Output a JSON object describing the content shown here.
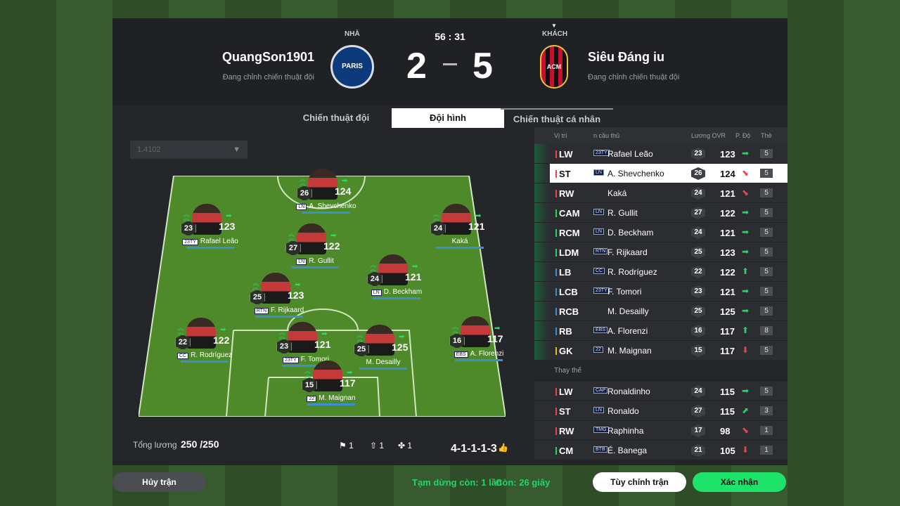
{
  "header": {
    "home_side": "NHÀ",
    "away_side": "KHÁCH",
    "home_name": "QuangSon1901",
    "away_name": "Siêu Đáng iu",
    "home_status": "Đang chỉnh chiến thuật đội",
    "away_status": "Đang chỉnh chiến thuật đội",
    "clock": "56 : 31",
    "home_score": "2",
    "away_score": "5",
    "home_crest": "PARIS",
    "away_crest": "ACM"
  },
  "tabs": [
    {
      "label": "Chiến thuật đội"
    },
    {
      "label": "Đội hình"
    },
    {
      "label": "Chiến thuật cá nhân"
    }
  ],
  "dropdown": {
    "value": "1.4102"
  },
  "players": [
    {
      "name": "A. Shevchenko",
      "badge": "LN",
      "rank": "26",
      "ovr": "124"
    },
    {
      "name": "Rafael Leão",
      "badge": "23TY",
      "rank": "23",
      "ovr": "123"
    },
    {
      "name": "Kaká",
      "badge": "",
      "rank": "24",
      "ovr": "121"
    },
    {
      "name": "R. Gullit",
      "badge": "LN",
      "rank": "27",
      "ovr": "122"
    },
    {
      "name": "D. Beckham",
      "badge": "LN",
      "rank": "24",
      "ovr": "121"
    },
    {
      "name": "F. Rijkaard",
      "badge": "RTN",
      "rank": "25",
      "ovr": "123"
    },
    {
      "name": "R. Rodríguez",
      "badge": "CC",
      "rank": "22",
      "ovr": "122"
    },
    {
      "name": "F. Tomori",
      "badge": "23TY",
      "rank": "23",
      "ovr": "121"
    },
    {
      "name": "M. Desailly",
      "badge": "",
      "rank": "25",
      "ovr": "125"
    },
    {
      "name": "A. Florenzi",
      "badge": "EBS",
      "rank": "16",
      "ovr": "117"
    },
    {
      "name": "M. Maignan",
      "badge": "22",
      "rank": "15",
      "ovr": "117"
    }
  ],
  "footer": {
    "total_label": "Tổng lương",
    "total_value": "250 /250",
    "c1": "1",
    "c2": "1",
    "c3": "1",
    "formation": "4-1-1-1-3"
  },
  "list": {
    "col_pos": "Vị trí",
    "col_name": "n cầu thủ",
    "col_ovr": "Lương OVR",
    "col_form": "P. Độ",
    "col_lvl": "Thẻ",
    "subs_label": "Thay thế",
    "rows": [
      {
        "pos": "LW",
        "badge": "23TY",
        "name": "Rafael Leão",
        "rank": "23",
        "ovr": "123",
        "trend": "➡",
        "lv": "5",
        "tc": "#2ad06a",
        "pc": "#e84848"
      },
      {
        "pos": "ST",
        "badge": "LN",
        "name": "A. Shevchenko",
        "rank": "26",
        "ovr": "124",
        "trend": "⬊",
        "lv": "5",
        "tc": "#e84848",
        "pc": "#e84848"
      },
      {
        "pos": "RW",
        "badge": "",
        "name": "Kaká",
        "rank": "24",
        "ovr": "121",
        "trend": "⬊",
        "lv": "5",
        "tc": "#e84848",
        "pc": "#e84848"
      },
      {
        "pos": "CAM",
        "badge": "LN",
        "name": "R. Gullit",
        "rank": "27",
        "ovr": "122",
        "trend": "➡",
        "lv": "5",
        "tc": "#2ad06a",
        "pc": "#2ad06a"
      },
      {
        "pos": "RCM",
        "badge": "LN",
        "name": "D. Beckham",
        "rank": "24",
        "ovr": "121",
        "trend": "➡",
        "lv": "5",
        "tc": "#2ad06a",
        "pc": "#2ad06a"
      },
      {
        "pos": "LDM",
        "badge": "RTN",
        "name": "F. Rijkaard",
        "rank": "25",
        "ovr": "123",
        "trend": "➡",
        "lv": "5",
        "tc": "#2ad06a",
        "pc": "#2ad06a"
      },
      {
        "pos": "LB",
        "badge": "CC",
        "name": "R. Rodríguez",
        "rank": "22",
        "ovr": "122",
        "trend": "⬆",
        "lv": "5",
        "tc": "#2ad06a",
        "pc": "#3a90d0"
      },
      {
        "pos": "LCB",
        "badge": "23TY",
        "name": "F. Tomori",
        "rank": "23",
        "ovr": "121",
        "trend": "➡",
        "lv": "5",
        "tc": "#2ad06a",
        "pc": "#3a90d0"
      },
      {
        "pos": "RCB",
        "badge": "",
        "name": "M. Desailly",
        "rank": "25",
        "ovr": "125",
        "trend": "➡",
        "lv": "5",
        "tc": "#2ad06a",
        "pc": "#3a90d0"
      },
      {
        "pos": "RB",
        "badge": "EBS",
        "name": "A. Florenzi",
        "rank": "16",
        "ovr": "117",
        "trend": "⬆",
        "lv": "8",
        "tc": "#2ad06a",
        "pc": "#3a90d0"
      },
      {
        "pos": "GK",
        "badge": "22",
        "name": "M. Maignan",
        "rank": "15",
        "ovr": "117",
        "trend": "⬇",
        "lv": "5",
        "tc": "#e84848",
        "pc": "#e8b830"
      }
    ],
    "subs": [
      {
        "pos": "LW",
        "badge": "CAP",
        "name": "Ronaldinho",
        "rank": "24",
        "ovr": "115",
        "trend": "➡",
        "lv": "5",
        "tc": "#2ad06a",
        "pc": "#e84848"
      },
      {
        "pos": "ST",
        "badge": "LN",
        "name": "Ronaldo",
        "rank": "27",
        "ovr": "115",
        "trend": "⬈",
        "lv": "3",
        "tc": "#2ad06a",
        "pc": "#e84848"
      },
      {
        "pos": "RW",
        "badge": "TMG",
        "name": "Raphinha",
        "rank": "17",
        "ovr": "98",
        "trend": "⬊",
        "lv": "1",
        "tc": "#e84848",
        "pc": "#e84848"
      },
      {
        "pos": "CM",
        "badge": "BTB",
        "name": "É. Banega",
        "rank": "21",
        "ovr": "105",
        "trend": "⬇",
        "lv": "1",
        "tc": "#e84848",
        "pc": "#2ad06a"
      }
    ]
  },
  "bottom": {
    "quit": "Hủy trận",
    "pause_label": "Tạm dừng còn: 1 lần",
    "time_label": "Còn: 26 giây",
    "adjust": "Tùy chỉnh trận",
    "confirm": "Xác nhận"
  }
}
